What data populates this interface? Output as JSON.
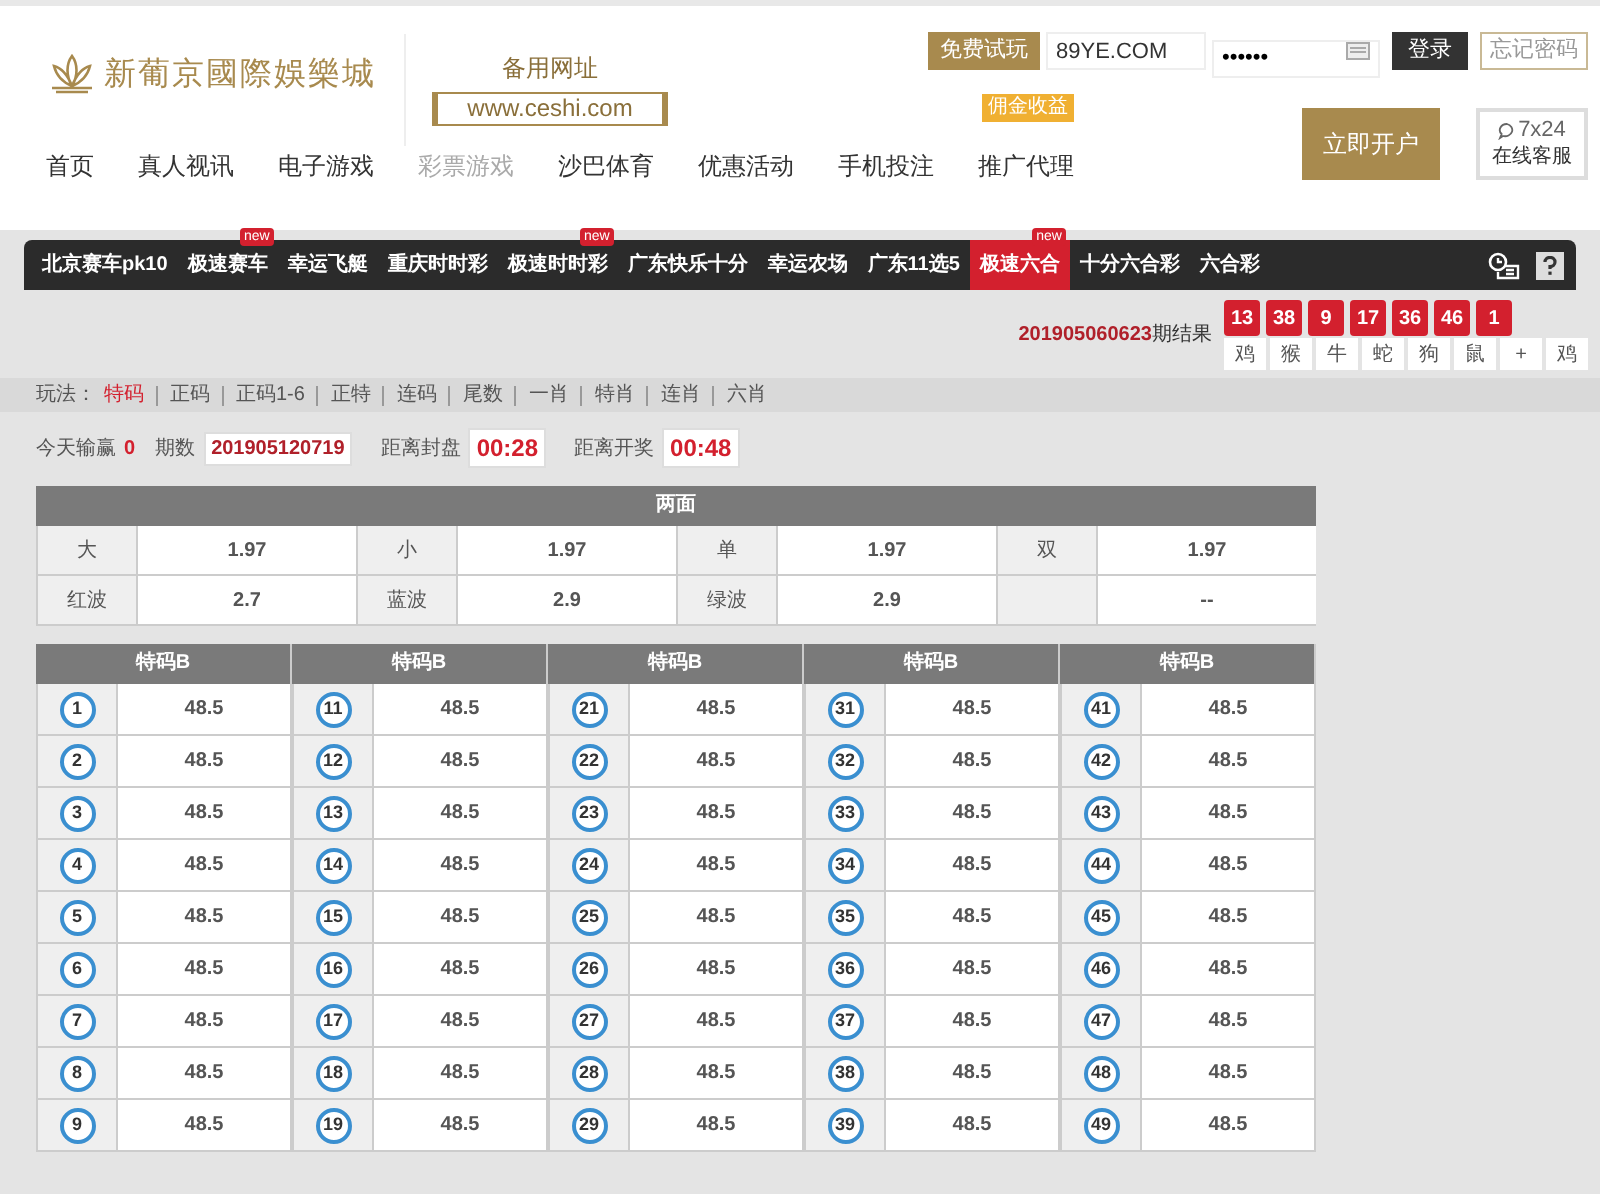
{
  "header": {
    "logo_text": "新葡京國際娛樂城",
    "backup_label": "备用网址",
    "backup_url": "www.ceshi.com"
  },
  "login": {
    "trial_button": "免费试玩",
    "username": "89YE.COM",
    "password": "••••••",
    "login_button": "登录",
    "forgot_button": "忘记密码"
  },
  "main_nav": [
    {
      "label": "首页",
      "selected": false
    },
    {
      "label": "真人视讯",
      "selected": false
    },
    {
      "label": "电子游戏",
      "selected": false
    },
    {
      "label": "彩票游戏",
      "selected": true
    },
    {
      "label": "沙巴体育",
      "selected": false
    },
    {
      "label": "优惠活动",
      "selected": false
    },
    {
      "label": "手机投注",
      "selected": false
    },
    {
      "label": "推广代理",
      "selected": false,
      "badge": "佣金收益"
    }
  ],
  "open_account_button": "立即开户",
  "support": {
    "hours": "7x24",
    "label": "在线客服"
  },
  "game_tabs": [
    {
      "label": "北京赛车pk10",
      "selected": false
    },
    {
      "label": "极速赛车",
      "selected": false,
      "badge": "new"
    },
    {
      "label": "幸运飞艇",
      "selected": false
    },
    {
      "label": "重庆时时彩",
      "selected": false
    },
    {
      "label": "极速时时彩",
      "selected": false,
      "badge": "new"
    },
    {
      "label": "广东快乐十分",
      "selected": false
    },
    {
      "label": "幸运农场",
      "selected": false
    },
    {
      "label": "广东11选5",
      "selected": false
    },
    {
      "label": "极速六合",
      "selected": true,
      "badge": "new"
    },
    {
      "label": "十分六合彩",
      "selected": false
    },
    {
      "label": "六合彩",
      "selected": false
    }
  ],
  "draw_result": {
    "period": "201905060623",
    "suffix": "期结果",
    "numbers": [
      "13",
      "38",
      "9",
      "17",
      "36",
      "46",
      "1"
    ],
    "zodiacs": [
      "鸡",
      "猴",
      "牛",
      "蛇",
      "狗",
      "鼠",
      "+",
      "鸡"
    ]
  },
  "play_types": {
    "label": "玩法：",
    "items": [
      {
        "label": "特码",
        "selected": true
      },
      {
        "label": "正码",
        "selected": false
      },
      {
        "label": "正码1-6",
        "selected": false
      },
      {
        "label": "正特",
        "selected": false
      },
      {
        "label": "连码",
        "selected": false
      },
      {
        "label": "尾数",
        "selected": false
      },
      {
        "label": "一肖",
        "selected": false
      },
      {
        "label": "特肖",
        "selected": false
      },
      {
        "label": "连肖",
        "selected": false
      },
      {
        "label": "六肖",
        "selected": false
      }
    ]
  },
  "status": {
    "win_label": "今天输赢",
    "win_value": "0",
    "period_label": "期数",
    "period": "201905120719",
    "close_label": "距离封盘",
    "close_time": "00:28",
    "draw_label": "距离开奖",
    "draw_time": "00:48"
  },
  "two_sides": {
    "title": "两面",
    "rows": [
      [
        {
          "label": "大",
          "value": "1.97"
        },
        {
          "label": "小",
          "value": "1.97"
        },
        {
          "label": "单",
          "value": "1.97"
        },
        {
          "label": "双",
          "value": "1.97"
        }
      ],
      [
        {
          "label": "红波",
          "value": "2.7"
        },
        {
          "label": "蓝波",
          "value": "2.9"
        },
        {
          "label": "绿波",
          "value": "2.9"
        },
        {
          "value": "--"
        }
      ]
    ]
  },
  "special": {
    "columns": [
      {
        "title": "特码B",
        "rows": [
          {
            "number": "1",
            "odds": "48.5"
          },
          {
            "number": "2",
            "odds": "48.5"
          },
          {
            "number": "3",
            "odds": "48.5"
          },
          {
            "number": "4",
            "odds": "48.5"
          },
          {
            "number": "5",
            "odds": "48.5"
          },
          {
            "number": "6",
            "odds": "48.5"
          },
          {
            "number": "7",
            "odds": "48.5"
          },
          {
            "number": "8",
            "odds": "48.5"
          },
          {
            "number": "9",
            "odds": "48.5"
          }
        ]
      },
      {
        "title": "特码B",
        "rows": [
          {
            "number": "11",
            "odds": "48.5"
          },
          {
            "number": "12",
            "odds": "48.5"
          },
          {
            "number": "13",
            "odds": "48.5"
          },
          {
            "number": "14",
            "odds": "48.5"
          },
          {
            "number": "15",
            "odds": "48.5"
          },
          {
            "number": "16",
            "odds": "48.5"
          },
          {
            "number": "17",
            "odds": "48.5"
          },
          {
            "number": "18",
            "odds": "48.5"
          },
          {
            "number": "19",
            "odds": "48.5"
          }
        ]
      },
      {
        "title": "特码B",
        "rows": [
          {
            "number": "21",
            "odds": "48.5"
          },
          {
            "number": "22",
            "odds": "48.5"
          },
          {
            "number": "23",
            "odds": "48.5"
          },
          {
            "number": "24",
            "odds": "48.5"
          },
          {
            "number": "25",
            "odds": "48.5"
          },
          {
            "number": "26",
            "odds": "48.5"
          },
          {
            "number": "27",
            "odds": "48.5"
          },
          {
            "number": "28",
            "odds": "48.5"
          },
          {
            "number": "29",
            "odds": "48.5"
          }
        ]
      },
      {
        "title": "特码B",
        "rows": [
          {
            "number": "31",
            "odds": "48.5"
          },
          {
            "number": "32",
            "odds": "48.5"
          },
          {
            "number": "33",
            "odds": "48.5"
          },
          {
            "number": "34",
            "odds": "48.5"
          },
          {
            "number": "35",
            "odds": "48.5"
          },
          {
            "number": "36",
            "odds": "48.5"
          },
          {
            "number": "37",
            "odds": "48.5"
          },
          {
            "number": "38",
            "odds": "48.5"
          },
          {
            "number": "39",
            "odds": "48.5"
          }
        ]
      },
      {
        "title": "特码B",
        "rows": [
          {
            "number": "41",
            "odds": "48.5"
          },
          {
            "number": "42",
            "odds": "48.5"
          },
          {
            "number": "43",
            "odds": "48.5"
          },
          {
            "number": "44",
            "odds": "48.5"
          },
          {
            "number": "45",
            "odds": "48.5"
          },
          {
            "number": "46",
            "odds": "48.5"
          },
          {
            "number": "47",
            "odds": "48.5"
          },
          {
            "number": "48",
            "odds": "48.5"
          },
          {
            "number": "49",
            "odds": "48.5"
          }
        ]
      }
    ]
  }
}
